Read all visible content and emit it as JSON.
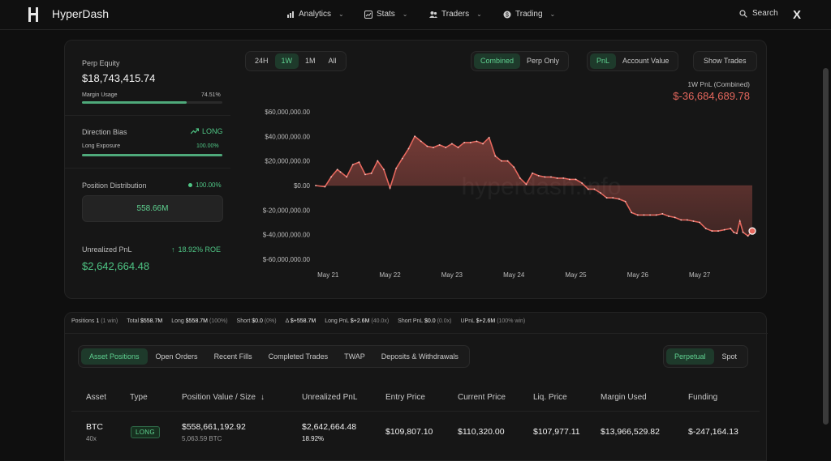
{
  "nav": {
    "brand": "HyperDash",
    "menus": [
      {
        "label": "Analytics",
        "icon": "chart-bars-icon"
      },
      {
        "label": "Stats",
        "icon": "stats-icon"
      },
      {
        "label": "Traders",
        "icon": "users-icon"
      },
      {
        "label": "Trading",
        "icon": "dollar-circle-icon"
      }
    ],
    "search_label": "Search",
    "social_label": "X"
  },
  "summary": {
    "perp_equity_label": "Perp Equity",
    "perp_equity_value": "$18,743,415.74",
    "margin_usage_label": "Margin Usage",
    "margin_usage_value": "74.51%",
    "margin_usage_fraction": 0.7451,
    "direction_bias_label": "Direction Bias",
    "direction_bias_value": "LONG",
    "long_exposure_label": "Long Exposure",
    "long_exposure_value": "100.00%",
    "long_exposure_fraction": 1.0,
    "position_distribution_label": "Position Distribution",
    "position_distribution_value": "100.00%",
    "position_distribution_amount": "558.66M",
    "unrealized_pnl_label": "Unrealized PnL",
    "unrealized_pnl_roe": "18.92% ROE",
    "unrealized_pnl_value": "$2,642,664.48"
  },
  "chart_controls": {
    "ranges": [
      "24H",
      "1W",
      "1M",
      "All"
    ],
    "range_selected": "1W",
    "modes": [
      "Combined",
      "Perp Only"
    ],
    "mode_selected": "Combined",
    "metrics": [
      "PnL",
      "Account Value"
    ],
    "metric_selected": "PnL",
    "show_trades": "Show Trades"
  },
  "chart_header": {
    "label": "1W PnL (Combined)",
    "value": "$-36,684,689.78"
  },
  "chart_data": {
    "type": "area",
    "title": "1W PnL (Combined)",
    "xlabel": "",
    "ylabel": "",
    "watermark": "hyperdash.info",
    "ylim": [
      -60000000,
      60000000
    ],
    "y_ticks": [
      "$60,000,000.00",
      "$40,000,000.00",
      "$20,000,000.00",
      "$0.00",
      "$-20,000,000.00",
      "$-40,000,000.00",
      "$-60,000,000.00"
    ],
    "y_tick_values": [
      60000000,
      40000000,
      20000000,
      0,
      -20000000,
      -40000000,
      -60000000
    ],
    "x_ticks": [
      "May 21",
      "May 22",
      "May 23",
      "May 24",
      "May 25",
      "May 26",
      "May 27"
    ],
    "x_range_days": [
      20.8,
      27.85
    ],
    "x_tick_days": [
      21,
      22,
      23,
      24,
      25,
      26,
      27
    ],
    "line_color": "#e5675d",
    "series": [
      {
        "x": [
          20.8,
          20.95,
          21.05,
          21.15,
          21.2,
          21.3,
          21.4,
          21.5,
          21.6,
          21.7,
          21.8,
          21.9,
          22.0,
          22.1,
          22.2,
          22.3,
          22.4,
          22.5,
          22.6,
          22.7,
          22.8,
          22.9,
          23.0,
          23.1,
          23.2,
          23.3,
          23.4,
          23.5,
          23.6,
          23.7,
          23.8,
          23.9,
          24.0,
          24.1,
          24.2,
          24.3,
          24.4,
          24.5,
          24.6,
          24.7,
          24.8,
          24.9,
          25.0,
          25.1,
          25.2,
          25.3,
          25.4,
          25.5,
          25.6,
          25.7,
          25.8,
          25.9,
          26.0,
          26.1,
          26.2,
          26.3,
          26.4,
          26.5,
          26.6,
          26.7,
          26.8,
          26.9,
          27.0,
          27.1,
          27.2,
          27.3,
          27.4,
          27.5,
          27.55,
          27.6,
          27.65,
          27.7,
          27.78,
          27.85
        ],
        "y": [
          0,
          -1000000,
          7000000,
          13000000,
          11000000,
          7000000,
          17000000,
          19000000,
          9000000,
          10000000,
          20000000,
          13000000,
          -2000000,
          14000000,
          22000000,
          30000000,
          40000000,
          36000000,
          32000000,
          31000000,
          33000000,
          31000000,
          34000000,
          31000000,
          35000000,
          35000000,
          36000000,
          34000000,
          39000000,
          24000000,
          20000000,
          20000000,
          15000000,
          6000000,
          1000000,
          10000000,
          8000000,
          7000000,
          7000000,
          6000000,
          6000000,
          5000000,
          5000000,
          2000000,
          -3000000,
          -3000000,
          -6000000,
          -10000000,
          -10000000,
          -11000000,
          -13000000,
          -22000000,
          -24000000,
          -24000000,
          -24000000,
          -24000000,
          -23000000,
          -25000000,
          -26000000,
          -28000000,
          -28000000,
          -29000000,
          -30000000,
          -35000000,
          -37000000,
          -37000000,
          -36000000,
          -35000000,
          -38000000,
          -39000000,
          -29000000,
          -38000000,
          -41000000,
          -37000000
        ]
      }
    ]
  },
  "positions_summary": {
    "positions_label": "Positions",
    "positions_count": "1",
    "positions_wins": "(1 win)",
    "total_label": "Total",
    "total_value": "$558.7M",
    "long_label": "Long",
    "long_value": "$558.7M",
    "long_pct": "(100%)",
    "short_label": "Short",
    "short_value": "$0.0",
    "short_pct": "(0%)",
    "delta_label": "Δ",
    "delta_value": "$+558.7M",
    "long_pnl_label": "Long PnL",
    "long_pnl_value": "$+2.6M",
    "long_pnl_x": "(40.0x)",
    "short_pnl_label": "Short PnL",
    "short_pnl_value": "$0.0",
    "short_pnl_x": "(0.0x)",
    "upnl_label": "UPnL",
    "upnl_value": "$+2.6M",
    "upnl_win": "(100% win)"
  },
  "table_tabs": [
    "Asset Positions",
    "Open Orders",
    "Recent Fills",
    "Completed Trades",
    "TWAP",
    "Deposits & Withdrawals"
  ],
  "table_tab_selected": "Asset Positions",
  "market_tabs": [
    "Perpetual",
    "Spot"
  ],
  "market_tab_selected": "Perpetual",
  "table": {
    "headers": [
      "Asset",
      "Type",
      "Position Value / Size",
      "Unrealized PnL",
      "Entry Price",
      "Current Price",
      "Liq. Price",
      "Margin Used",
      "Funding"
    ],
    "rows": [
      {
        "asset": "BTC",
        "leverage": "40x",
        "type": "LONG",
        "position_value": "$558,661,192.92",
        "position_size": "5,063.59 BTC",
        "unrealized_pnl": "$2,642,664.48",
        "unrealized_pct": "18.92%",
        "entry_price": "$109,807.10",
        "current_price": "$110,320.00",
        "liq_price": "$107,977.11",
        "margin_used": "$13,966,529.82",
        "funding": "$-247,164.13"
      }
    ]
  }
}
